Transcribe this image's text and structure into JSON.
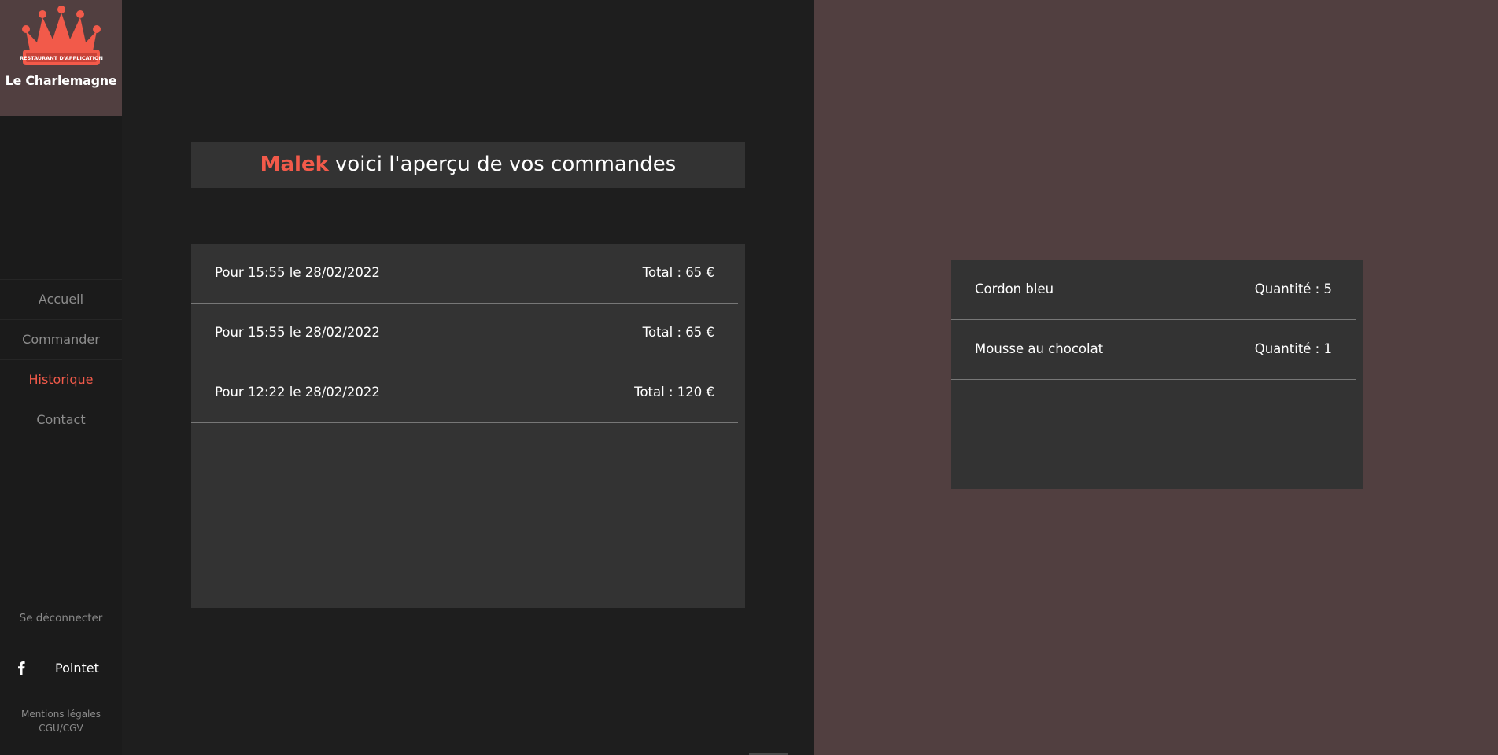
{
  "brand": {
    "badge_text": "RESTAURANT D'APPLICATION",
    "name": "Le Charlemagne",
    "accent_color": "#f25a4a"
  },
  "nav": {
    "items": [
      {
        "label": "Accueil"
      },
      {
        "label": "Commander"
      },
      {
        "label": "Historique",
        "active": true
      },
      {
        "label": "Contact"
      }
    ]
  },
  "sidebar": {
    "logout_label": "Se déconnecter",
    "social_icon": "facebook-icon",
    "social_label": "Pointet",
    "legal_line1": "Mentions légales",
    "legal_line2": "CGU/CGV"
  },
  "header": {
    "user_name": "Malek",
    "message": "voici l'aperçu de vos commandes"
  },
  "orders": [
    {
      "date": "Pour 15:55 le 28/02/2022",
      "total": "Total : 65 €"
    },
    {
      "date": "Pour 15:55 le 28/02/2022",
      "total": "Total : 65 €"
    },
    {
      "date": "Pour 12:22 le 28/02/2022",
      "total": "Total : 120 €"
    }
  ],
  "order_details": [
    {
      "name": "Cordon bleu",
      "quantity": "Quantité : 5"
    },
    {
      "name": "Mousse au chocolat",
      "quantity": "Quantité : 1"
    }
  ]
}
